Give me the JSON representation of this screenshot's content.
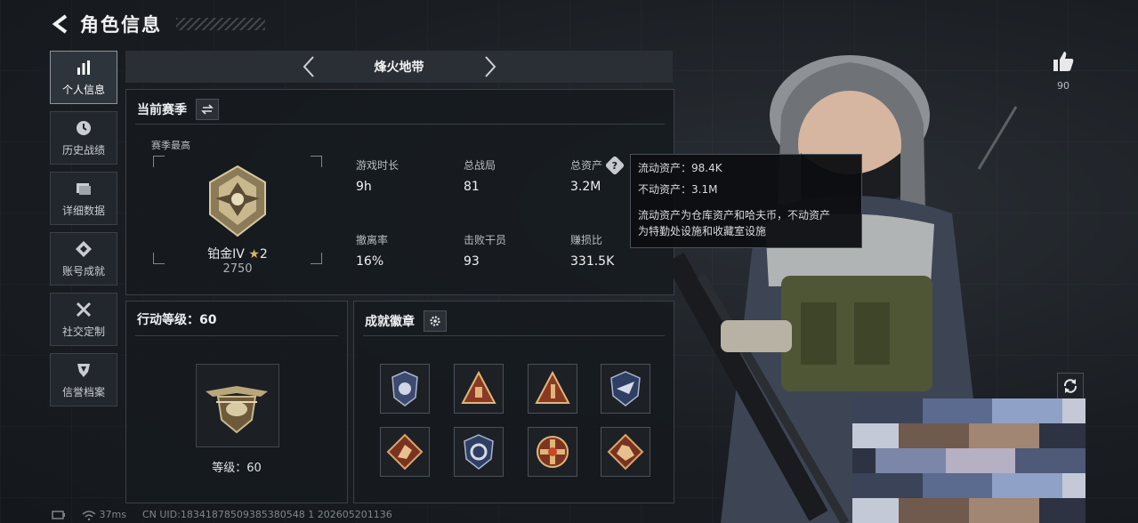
{
  "header": {
    "title": "角色信息"
  },
  "sidebar": {
    "items": [
      {
        "label": "个人信息",
        "icon": "bar-chart-icon",
        "active": true
      },
      {
        "label": "历史战绩",
        "icon": "clock-icon",
        "active": false
      },
      {
        "label": "详细数据",
        "icon": "folder-icon",
        "active": false
      },
      {
        "label": "账号成就",
        "icon": "medal-icon",
        "active": false
      },
      {
        "label": "社交定制",
        "icon": "tools-icon",
        "active": false
      },
      {
        "label": "信誉档案",
        "icon": "shield-icon",
        "active": false
      }
    ]
  },
  "mode": {
    "name": "烽火地带"
  },
  "season": {
    "title": "当前赛季",
    "peak_label": "赛季最高",
    "rank_name": "铂金IV",
    "rank_star": "★",
    "rank_star_count": "2",
    "rank_score": "2750",
    "stats": [
      {
        "label": "游戏时长",
        "value": "9h"
      },
      {
        "label": "总战局",
        "value": "81"
      },
      {
        "label": "总资产",
        "value": "3.2M",
        "help": "?"
      },
      {
        "label": "撤离率",
        "value": "16%"
      },
      {
        "label": "击败干员",
        "value": "93"
      },
      {
        "label": "赚损比",
        "value": "331.5K"
      }
    ]
  },
  "tooltip": {
    "line1": "流动资产：98.4K",
    "line2": "不动资产：3.1M",
    "line3": "流动资产为仓库资产和哈夫币，不动资产",
    "line4": "为特勤处设施和收藏室设施"
  },
  "action_level": {
    "title": "行动等级：60",
    "level_text": "等级：60"
  },
  "achievements": {
    "title": "成就徽章",
    "badges": [
      "police-badge-icon",
      "triangle-bar-badge-icon",
      "triangle-one-badge-icon",
      "wing-shield-badge-icon",
      "runner-badge-icon",
      "shield-swirl-badge-icon",
      "cross-star-badge-icon",
      "beast-badge-icon"
    ]
  },
  "like": {
    "count": "90"
  },
  "footer": {
    "ping": "37ms",
    "uid": "CN UID:18341878509385380548 1 202605201136"
  },
  "colors": {
    "accent_gold": "#d9b56a",
    "panel_border": "#3a4047",
    "background": "#1a1e23"
  }
}
